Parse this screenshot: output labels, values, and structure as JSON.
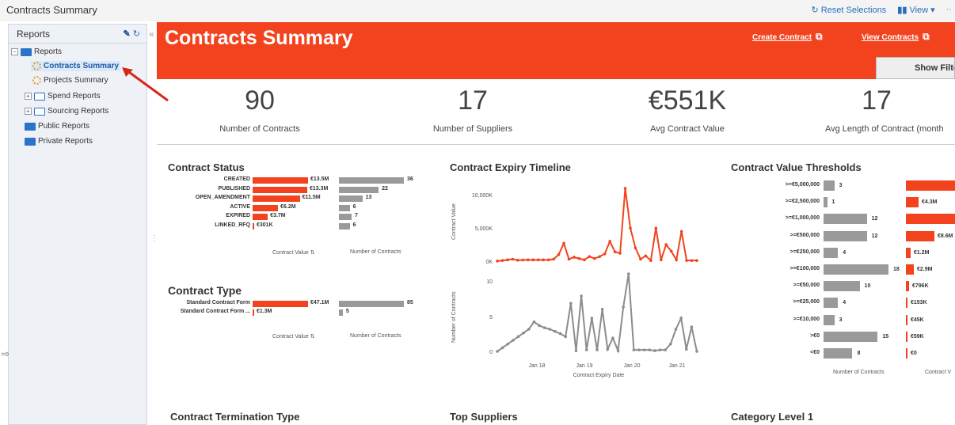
{
  "app": {
    "title": "Contracts Summary",
    "reset_label": "Reset Selections",
    "view_label": "View",
    "more_label": "··"
  },
  "sidebar": {
    "header": "Reports",
    "items": [
      {
        "label": "Reports",
        "icon": "folder-open-icon"
      },
      {
        "label": "Contracts Summary",
        "icon": "report-icon",
        "selected": true
      },
      {
        "label": "Projects Summary",
        "icon": "report-icon"
      },
      {
        "label": "Spend Reports",
        "icon": "folder-icon"
      },
      {
        "label": "Sourcing Reports",
        "icon": "folder-icon"
      },
      {
        "label": "Public Reports",
        "icon": "folder-open-icon"
      },
      {
        "label": "Private Reports",
        "icon": "folder-open-icon"
      }
    ]
  },
  "banner": {
    "title": "Contracts Summary",
    "create_label": "Create Contract",
    "view_label": "View Contracts",
    "show_filters_label": "Show Filte",
    "color": "#f2431e"
  },
  "kpis": [
    {
      "value": "90",
      "label": "Number of Contracts"
    },
    {
      "value": "17",
      "label": "Number of Suppliers"
    },
    {
      "value": "€551K",
      "label": "Avg Contract Value"
    },
    {
      "value": "17",
      "label": "Avg Length of Contract (month"
    }
  ],
  "colors": {
    "accent": "#f2431e",
    "secondary": "#9a9a9a"
  },
  "chart_data": [
    {
      "type": "bar",
      "title": "Contract Status",
      "categories": [
        "CREATED",
        "PUBLISHED",
        "OPEN_AMENDMENT",
        "ACTIVE",
        "EXPIRED",
        "LINKED_RFQ"
      ],
      "series": [
        {
          "name": "Contract Value",
          "values": [
            13.5,
            13.3,
            11.5,
            6.2,
            3.7,
            0.301
          ],
          "labels": [
            "€13.5M",
            "€13.3M",
            "€11.5M",
            "€6.2M",
            "€3.7M",
            "€301K"
          ]
        },
        {
          "name": "Number of Contracts",
          "values": [
            36,
            22,
            13,
            6,
            7,
            6
          ]
        }
      ]
    },
    {
      "type": "bar",
      "title": "Contract Type",
      "categories": [
        "Standard Contract Form",
        "Standard Contract Form ..."
      ],
      "series": [
        {
          "name": "Contract Value",
          "values": [
            47.1,
            1.3
          ],
          "labels": [
            "€47.1M",
            "€1.3M"
          ]
        },
        {
          "name": "Number of Contracts",
          "values": [
            85,
            5
          ]
        }
      ]
    },
    {
      "type": "line",
      "title": "Contract Expiry Timeline",
      "xlabel": "Contract Expiry Date",
      "x_ticks": [
        "Jan 18",
        "Jan 19",
        "Jan 20",
        "Jan 21"
      ],
      "panels": [
        {
          "ylabel": "Contract Value",
          "y_ticks": [
            "10,000K",
            "5,000K",
            "0K"
          ],
          "ylim": [
            0,
            11000
          ],
          "values": [
            20,
            100,
            200,
            300,
            150,
            180,
            200,
            200,
            200,
            200,
            200,
            300,
            1000,
            2700,
            300,
            600,
            400,
            200,
            700,
            400,
            700,
            1100,
            3000,
            1400,
            1200,
            11000,
            5000,
            2000,
            300,
            800,
            100,
            5000,
            200,
            2500,
            1500,
            200,
            4500,
            100,
            100,
            100
          ]
        },
        {
          "ylabel": "Number of Contracts",
          "y_ticks": [
            "10",
            "5",
            "0"
          ],
          "ylim": [
            0,
            10.5
          ],
          "values": [
            0,
            0.5,
            1,
            1.5,
            2,
            2.5,
            3,
            4,
            3.5,
            3.2,
            3,
            2.7,
            2.4,
            2,
            6.5,
            0.1,
            7.5,
            0.2,
            4.5,
            0.2,
            5.7,
            0.3,
            1.8,
            0.1,
            6,
            10.5,
            0.2,
            0.2,
            0.2,
            0.2,
            0.1,
            0.2,
            0.2,
            1,
            3,
            4.5,
            0.3,
            3.3,
            0
          ]
        }
      ]
    },
    {
      "type": "bar",
      "title": "Contract Value Thresholds",
      "categories": [
        ">=€5,000,000",
        ">=€2,500,000",
        ">=€1,000,000",
        ">=€500,000",
        ">=€250,000",
        ">=€100,000",
        ">=€50,000",
        ">=€25,000",
        ">=€10,000",
        ">€0",
        "<€0"
      ],
      "series": [
        {
          "name": "Number of Contracts",
          "values": [
            3,
            1,
            12,
            12,
            4,
            18,
            10,
            4,
            3,
            15,
            8
          ]
        },
        {
          "name": "Contract V",
          "labels": [
            "",
            "€4.3M",
            "",
            "€8.6M",
            "€1.2M",
            "€2.9M",
            "€796K",
            "€153K",
            "€45K",
            "€59K",
            "€0"
          ]
        }
      ]
    }
  ],
  "bottom_sections": [
    "Contract Termination Type",
    "Top Suppliers",
    "Category Level 1"
  ]
}
